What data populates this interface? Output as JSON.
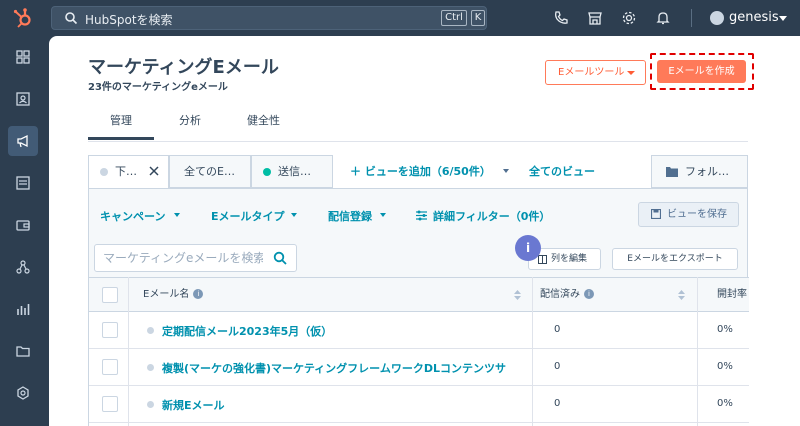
{
  "topbar": {
    "search_placeholder": "HubSpotを検索",
    "kbd_ctrl": "Ctrl",
    "kbd_k": "K",
    "account_name": "genesis"
  },
  "colors": {
    "nav_bg": "#2d3e50",
    "accent": "#ff7a59",
    "link": "#0091ae",
    "highlight_border": "#e00000"
  },
  "sidebar": {
    "items": [
      {
        "icon": "grid-icon"
      },
      {
        "icon": "contacts-icon"
      },
      {
        "icon": "megaphone-icon",
        "active": true
      },
      {
        "icon": "inbox-icon"
      },
      {
        "icon": "wallet-icon"
      },
      {
        "icon": "network-icon"
      },
      {
        "icon": "reports-icon"
      },
      {
        "icon": "folder-icon"
      },
      {
        "icon": "settings-icon"
      }
    ]
  },
  "header": {
    "title": "マーケティングEメール",
    "subtitle": "23件のマーケティングeメール",
    "tools_button": "Eメールツール",
    "create_button": "Eメールを作成"
  },
  "tabs": [
    "管理",
    "分析",
    "健全性"
  ],
  "views": {
    "tabs": [
      {
        "label": "下…",
        "dot_color": "#cbd6e2"
      },
      {
        "label": "全てのE…"
      },
      {
        "label": "送信…",
        "dot_color": "#00bda5"
      }
    ],
    "add_view": "ビューを追加（6/50件）",
    "all_views": "全てのビュー",
    "folder": "フォル…"
  },
  "filters": {
    "campaign": "キャンペーン",
    "email_type": "Eメールタイプ",
    "subscription": "配信登録",
    "advanced": "詳細フィルター（0件）",
    "save_view": "ビューを保存"
  },
  "table_tools": {
    "search_placeholder": "マーケティングeメールを検索",
    "info_badge": "i",
    "edit_columns": "列を編集",
    "export": "Eメールをエクスポート"
  },
  "table": {
    "columns": [
      "Eメール名",
      "配信済み",
      "開封率"
    ],
    "rows": [
      {
        "name": "定期配信メール2023年5月（仮）",
        "sent": "0",
        "open_rate": "0%"
      },
      {
        "name": "複製(マーケの強化書)マーケティングフレームワークDLコンテンツサ",
        "sent": "0",
        "open_rate": "0%"
      },
      {
        "name": "新規Eメール",
        "sent": "0",
        "open_rate": "0%"
      }
    ]
  }
}
